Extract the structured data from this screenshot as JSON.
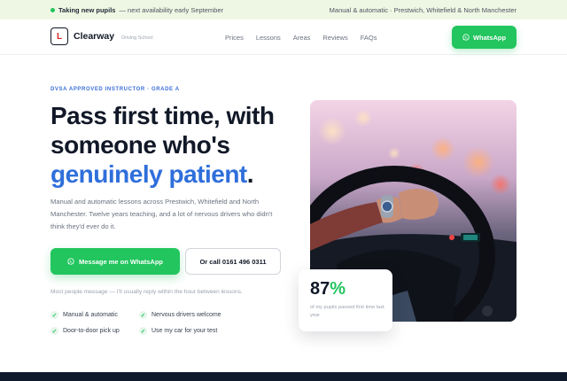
{
  "topbar": {
    "status_bold": "Taking new pupils",
    "status_rest": "— next availability early September",
    "service": "Manual & automatic · Prestwich, Whitefield & North Manchester"
  },
  "header": {
    "logo_letter": "L",
    "brand": "Clearway",
    "brand_sub": "Driving School",
    "nav": [
      "Prices",
      "Lessons",
      "Areas",
      "Reviews",
      "FAQs"
    ],
    "cta": "WhatsApp"
  },
  "hero": {
    "eyebrow": "DVSA APPROVED INSTRUCTOR · GRADE A",
    "headline_line1": "Pass first time, with",
    "headline_line2": "someone who's",
    "headline_highlight": "genuinely patient",
    "headline_end": ".",
    "lede": "Manual and automatic lessons across Prestwich, Whitefield and North Manchester. Twelve years teaching, and a lot of nervous drivers who didn't think they'd ever do it.",
    "primary_cta": "Message me on WhatsApp",
    "secondary_cta": "Or call 0161 496 0311",
    "note": "Most people message — I'll usually reply within the hour between lessons.",
    "features": [
      "Manual & automatic",
      "Nervous drivers welcome",
      "Door-to-door pick up",
      "Use my car for your test"
    ]
  },
  "stat": {
    "value": "87",
    "unit": "%",
    "caption": "of my pupils passed first time last year"
  },
  "colors": {
    "accent_green": "#22c55e",
    "accent_blue": "#2f6fdb",
    "logo_red": "#dc2626",
    "footer_navy": "#0f1b2d"
  },
  "icons": [
    "whatsapp-icon",
    "check-icon",
    "status-dot-icon"
  ]
}
